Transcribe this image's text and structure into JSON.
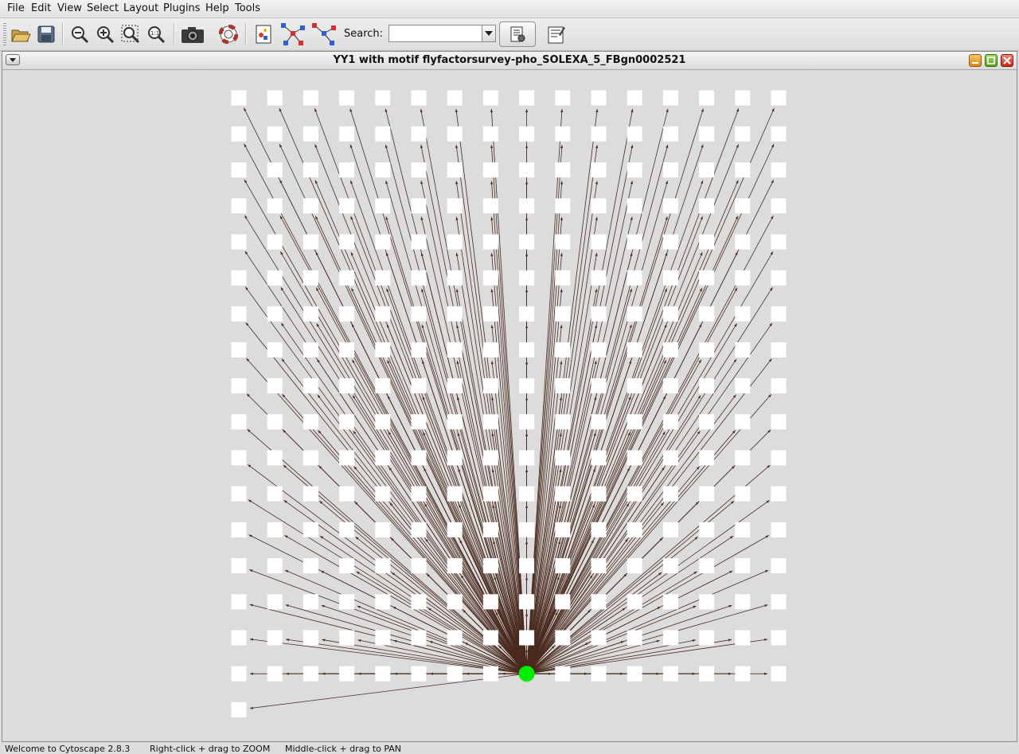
{
  "menu": [
    "File",
    "Edit",
    "View",
    "Select",
    "Layout",
    "Plugins",
    "Help",
    "Tools"
  ],
  "toolbar": {
    "buttons": [
      "open-icon",
      "save-icon",
      "zoom-out-icon",
      "zoom-in-icon",
      "zoom-selected-icon",
      "zoom-actual-icon",
      "screenshot-icon",
      "help-icon",
      "vizmapper-icon",
      "first-neighbors-icon",
      "hide-edges-icon"
    ],
    "search_label": "Search:",
    "search_value": "",
    "search_options_icon": "search-options-icon",
    "last_button_icon": "filter-icon"
  },
  "window": {
    "title": "YY1 with motif flyfactorsurvey-pho_SOLEXA_5_FBgn0002521",
    "controls": [
      "minimize-icon",
      "maximize-icon",
      "close-icon"
    ]
  },
  "network": {
    "grid_columns": 16,
    "grid_rows": 17,
    "extra_nodes": 1,
    "center_node_color": "#00ee00",
    "node_color": "#ffffff",
    "edge_color": "#4a2a1e",
    "background": "#dcdcdc"
  },
  "status": {
    "welcome": "Welcome to Cytoscape 2.8.3",
    "zoom_hint": "Right-click + drag to ZOOM",
    "pan_hint": "Middle-click + drag to PAN"
  }
}
